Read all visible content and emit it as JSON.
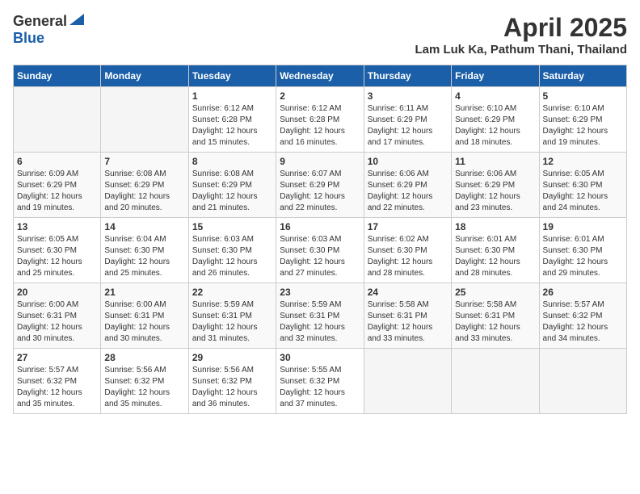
{
  "header": {
    "logo_general": "General",
    "logo_blue": "Blue",
    "title": "April 2025",
    "subtitle": "Lam Luk Ka, Pathum Thani, Thailand"
  },
  "calendar": {
    "days_of_week": [
      "Sunday",
      "Monday",
      "Tuesday",
      "Wednesday",
      "Thursday",
      "Friday",
      "Saturday"
    ],
    "weeks": [
      [
        {
          "day": "",
          "info": ""
        },
        {
          "day": "",
          "info": ""
        },
        {
          "day": "1",
          "info": "Sunrise: 6:12 AM\nSunset: 6:28 PM\nDaylight: 12 hours\nand 15 minutes."
        },
        {
          "day": "2",
          "info": "Sunrise: 6:12 AM\nSunset: 6:28 PM\nDaylight: 12 hours\nand 16 minutes."
        },
        {
          "day": "3",
          "info": "Sunrise: 6:11 AM\nSunset: 6:29 PM\nDaylight: 12 hours\nand 17 minutes."
        },
        {
          "day": "4",
          "info": "Sunrise: 6:10 AM\nSunset: 6:29 PM\nDaylight: 12 hours\nand 18 minutes."
        },
        {
          "day": "5",
          "info": "Sunrise: 6:10 AM\nSunset: 6:29 PM\nDaylight: 12 hours\nand 19 minutes."
        }
      ],
      [
        {
          "day": "6",
          "info": "Sunrise: 6:09 AM\nSunset: 6:29 PM\nDaylight: 12 hours\nand 19 minutes."
        },
        {
          "day": "7",
          "info": "Sunrise: 6:08 AM\nSunset: 6:29 PM\nDaylight: 12 hours\nand 20 minutes."
        },
        {
          "day": "8",
          "info": "Sunrise: 6:08 AM\nSunset: 6:29 PM\nDaylight: 12 hours\nand 21 minutes."
        },
        {
          "day": "9",
          "info": "Sunrise: 6:07 AM\nSunset: 6:29 PM\nDaylight: 12 hours\nand 22 minutes."
        },
        {
          "day": "10",
          "info": "Sunrise: 6:06 AM\nSunset: 6:29 PM\nDaylight: 12 hours\nand 22 minutes."
        },
        {
          "day": "11",
          "info": "Sunrise: 6:06 AM\nSunset: 6:29 PM\nDaylight: 12 hours\nand 23 minutes."
        },
        {
          "day": "12",
          "info": "Sunrise: 6:05 AM\nSunset: 6:30 PM\nDaylight: 12 hours\nand 24 minutes."
        }
      ],
      [
        {
          "day": "13",
          "info": "Sunrise: 6:05 AM\nSunset: 6:30 PM\nDaylight: 12 hours\nand 25 minutes."
        },
        {
          "day": "14",
          "info": "Sunrise: 6:04 AM\nSunset: 6:30 PM\nDaylight: 12 hours\nand 25 minutes."
        },
        {
          "day": "15",
          "info": "Sunrise: 6:03 AM\nSunset: 6:30 PM\nDaylight: 12 hours\nand 26 minutes."
        },
        {
          "day": "16",
          "info": "Sunrise: 6:03 AM\nSunset: 6:30 PM\nDaylight: 12 hours\nand 27 minutes."
        },
        {
          "day": "17",
          "info": "Sunrise: 6:02 AM\nSunset: 6:30 PM\nDaylight: 12 hours\nand 28 minutes."
        },
        {
          "day": "18",
          "info": "Sunrise: 6:01 AM\nSunset: 6:30 PM\nDaylight: 12 hours\nand 28 minutes."
        },
        {
          "day": "19",
          "info": "Sunrise: 6:01 AM\nSunset: 6:30 PM\nDaylight: 12 hours\nand 29 minutes."
        }
      ],
      [
        {
          "day": "20",
          "info": "Sunrise: 6:00 AM\nSunset: 6:31 PM\nDaylight: 12 hours\nand 30 minutes."
        },
        {
          "day": "21",
          "info": "Sunrise: 6:00 AM\nSunset: 6:31 PM\nDaylight: 12 hours\nand 30 minutes."
        },
        {
          "day": "22",
          "info": "Sunrise: 5:59 AM\nSunset: 6:31 PM\nDaylight: 12 hours\nand 31 minutes."
        },
        {
          "day": "23",
          "info": "Sunrise: 5:59 AM\nSunset: 6:31 PM\nDaylight: 12 hours\nand 32 minutes."
        },
        {
          "day": "24",
          "info": "Sunrise: 5:58 AM\nSunset: 6:31 PM\nDaylight: 12 hours\nand 33 minutes."
        },
        {
          "day": "25",
          "info": "Sunrise: 5:58 AM\nSunset: 6:31 PM\nDaylight: 12 hours\nand 33 minutes."
        },
        {
          "day": "26",
          "info": "Sunrise: 5:57 AM\nSunset: 6:32 PM\nDaylight: 12 hours\nand 34 minutes."
        }
      ],
      [
        {
          "day": "27",
          "info": "Sunrise: 5:57 AM\nSunset: 6:32 PM\nDaylight: 12 hours\nand 35 minutes."
        },
        {
          "day": "28",
          "info": "Sunrise: 5:56 AM\nSunset: 6:32 PM\nDaylight: 12 hours\nand 35 minutes."
        },
        {
          "day": "29",
          "info": "Sunrise: 5:56 AM\nSunset: 6:32 PM\nDaylight: 12 hours\nand 36 minutes."
        },
        {
          "day": "30",
          "info": "Sunrise: 5:55 AM\nSunset: 6:32 PM\nDaylight: 12 hours\nand 37 minutes."
        },
        {
          "day": "",
          "info": ""
        },
        {
          "day": "",
          "info": ""
        },
        {
          "day": "",
          "info": ""
        }
      ]
    ]
  }
}
